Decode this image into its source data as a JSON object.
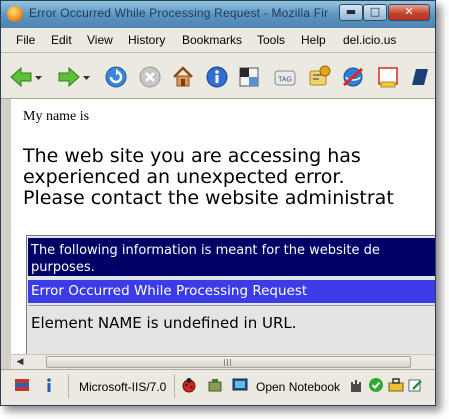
{
  "window": {
    "title": "Error Occurred While Processing Request - Mozilla Fire...",
    "minimize_glyph": "▬",
    "maximize_glyph": "□",
    "close_glyph": "✕"
  },
  "menu": [
    "File",
    "Edit",
    "View",
    "History",
    "Bookmarks",
    "Tools",
    "Help",
    "del.icio.us"
  ],
  "toolbar": {
    "icons": [
      "back-arrow-icon",
      "back-dropdown-icon",
      "forward-arrow-icon",
      "forward-dropdown-icon",
      "reload-icon",
      "stop-icon",
      "home-icon",
      "page-info-icon",
      "bookmarks-icon",
      "tag-icon",
      "extension-icon",
      "no-script-icon",
      "notepad-icon",
      "overflow-icon"
    ],
    "tag_label": "TAG"
  },
  "page": {
    "my_name": "My name is",
    "heading_lines": [
      "The web site you are accessing has",
      "experienced an unexpected error.",
      "Please contact the website administrat"
    ],
    "error_box": {
      "info_line1": "The following information is meant for the website de",
      "info_line2": "purposes.",
      "error_title": "Error Occurred While Processing Request",
      "error_detail": "Element NAME is undefined in URL."
    }
  },
  "status_bar": {
    "server_label": "Microsoft-IIS/7.0",
    "notebook_label": "Open Notebook",
    "icons": [
      "flag-icon",
      "info-icon",
      "ladybug-icon",
      "package-icon",
      "screen-icon",
      "castle-icon",
      "checkmark-icon",
      "toolbox-icon",
      "edit-icon"
    ]
  },
  "colors": {
    "info_row": "#000066",
    "error_title_row": "#3b3be8",
    "titlebar": "#5b93be"
  }
}
